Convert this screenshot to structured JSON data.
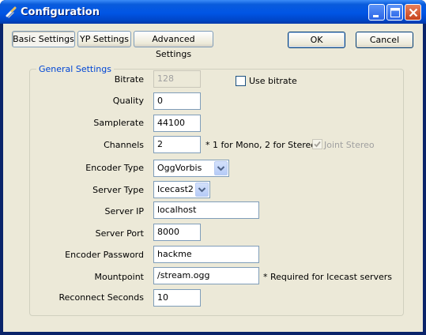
{
  "window": {
    "title": "Configuration",
    "icon": "app-icon",
    "controls": [
      "minimize-icon",
      "maximize-icon",
      "close-icon"
    ]
  },
  "tabs": {
    "basic": "Basic Settings",
    "yp": "YP Settings",
    "advanced": "Advanced Settings",
    "active": "Basic Settings"
  },
  "actions": {
    "ok": "OK",
    "cancel": "Cancel"
  },
  "general": {
    "group_label": "General Settings",
    "bitrate": {
      "label": "Bitrate",
      "value": "128",
      "enabled": false
    },
    "use_bitrate": {
      "label": "Use bitrate",
      "checked": false
    },
    "quality": {
      "label": "Quality",
      "value": "0"
    },
    "samplerate": {
      "label": "Samplerate",
      "value": "44100"
    },
    "channels": {
      "label": "Channels",
      "value": "2",
      "note": "* 1 for Mono, 2 for Stereo"
    },
    "joint_stereo": {
      "label": "Joint Stereo",
      "checked": true,
      "enabled": false
    },
    "encoder_type": {
      "label": "Encoder Type",
      "value": "OggVorbis"
    },
    "server_type": {
      "label": "Server Type",
      "value": "Icecast2"
    },
    "server_ip": {
      "label": "Server IP",
      "value": "localhost"
    },
    "server_port": {
      "label": "Server Port",
      "value": "8000"
    },
    "encoder_password": {
      "label": "Encoder Password",
      "value": "hackme"
    },
    "mountpoint": {
      "label": "Mountpoint",
      "value": "/stream.ogg",
      "note": "* Required for Icecast servers"
    },
    "reconnect_seconds": {
      "label": "Reconnect Seconds",
      "value": "10"
    }
  },
  "colors": {
    "titlebar": "#0055e5",
    "dialog_bg": "#ece9d8",
    "group_label": "#0046d5",
    "field_border": "#7f9db9"
  }
}
